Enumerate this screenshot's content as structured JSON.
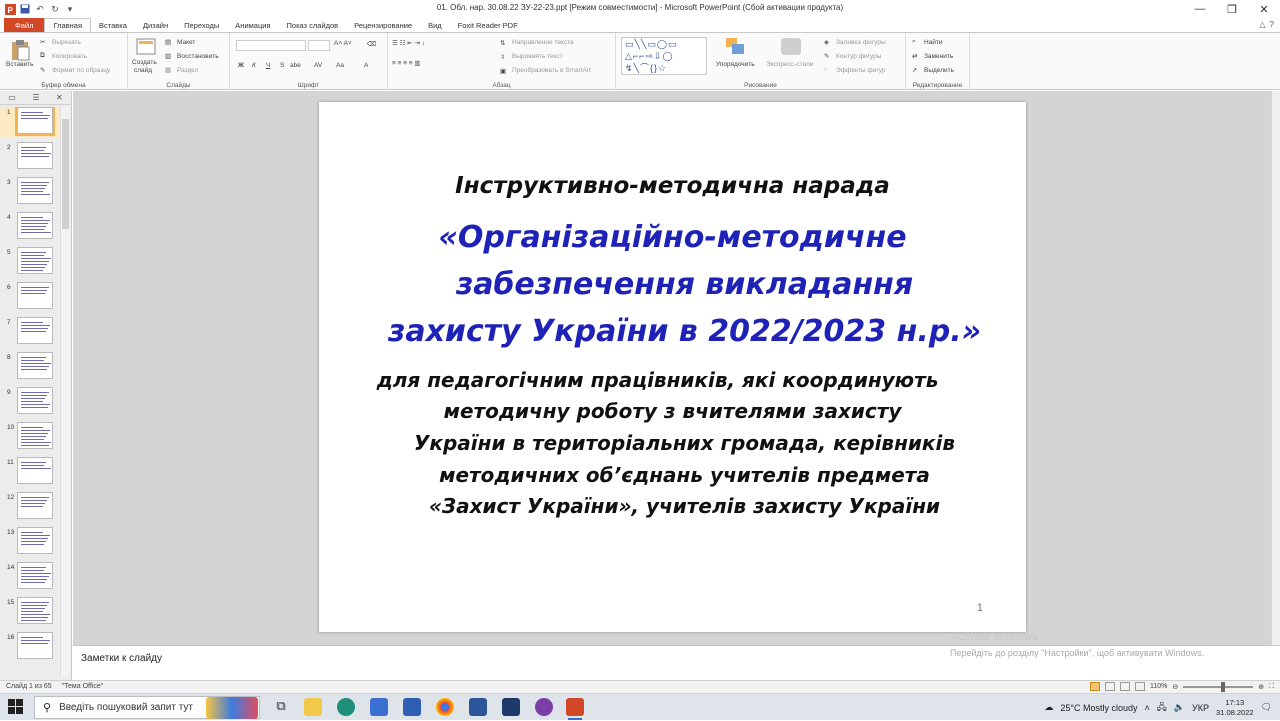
{
  "window": {
    "title": "01. Обл. нар. 30.08.22 ЗУ-22-23.ppt [Режим совместимости] - Microsoft PowerPoint (Сбой активации продукта)"
  },
  "tabs": [
    "Файл",
    "Главная",
    "Вставка",
    "Дизайн",
    "Переходы",
    "Анимация",
    "Показ слайдов",
    "Рецензирование",
    "Вид",
    "Foxit Reader PDF"
  ],
  "ribbon": {
    "clipboard": {
      "paste": "Вставить",
      "cut": "Вырезать",
      "copy": "Копировать",
      "format_painter": "Формат по образцу",
      "label": "Буфер обмена"
    },
    "slides": {
      "new_slide_line1": "Создать",
      "new_slide_line2": "слайд",
      "layout": "Макет",
      "reset": "Восстановить",
      "section": "Раздел",
      "label": "Слайды"
    },
    "font": {
      "label": "Шрифт",
      "bold": "Ж",
      "italic": "К",
      "underline": "Ч",
      "strike": "S",
      "shadow": "abe",
      "case": "Aa",
      "color": "A"
    },
    "paragraph": {
      "text_direction": "Направление текста",
      "align_text": "Выровнять текст",
      "smartart": "Преобразовать в SmartArt",
      "label": "Абзац"
    },
    "drawing": {
      "arrange": "Упорядочить",
      "quick_styles": "Экспресс-стили",
      "shape_fill": "Заливка фигуры",
      "shape_outline": "Контур фигуры",
      "shape_effects": "Эффекты фигур",
      "label": "Рисование"
    },
    "editing": {
      "find": "Найти",
      "replace": "Заменить",
      "select": "Выделить",
      "label": "Редактирование"
    }
  },
  "thumbnails": [
    "1",
    "2",
    "3",
    "4",
    "5",
    "6",
    "7",
    "8",
    "9",
    "10",
    "11",
    "12",
    "13",
    "14",
    "15",
    "16"
  ],
  "slide": {
    "subtitle": "Інструктивно-методична нарада",
    "title_lines": [
      "«Організаційно-методичне",
      "забезпечення викладання",
      "захисту України в 2022/2023 н.р.»"
    ],
    "description_lines": [
      "для педагогічним працівників, які координують",
      "методичну роботу з вчителями захисту",
      "України в територіальних громада, керівників",
      "методичних об’єднань учителів предмета",
      "«Захист України», учителів захисту України"
    ],
    "number": "1"
  },
  "notes": {
    "placeholder": "Заметки к слайду"
  },
  "watermark": {
    "line1": "Activate Windows",
    "line2": "Перейдіть до розділу \"Настройки\", щоб активувати Windows."
  },
  "status": {
    "slide_counter": "Слайд 1 из 65",
    "theme": "\"Тема Office\"",
    "zoom": "110%"
  },
  "taskbar": {
    "search_placeholder": "Введіть пошуковий запит тут",
    "weather": "25°C  Mostly cloudy",
    "language": "УКР",
    "time": "17:13",
    "date": "31.08.2022"
  },
  "colors": {
    "slide_title": "#1f22b6",
    "file_tab": "#d24726",
    "selected_thumb": "#f3b254"
  }
}
